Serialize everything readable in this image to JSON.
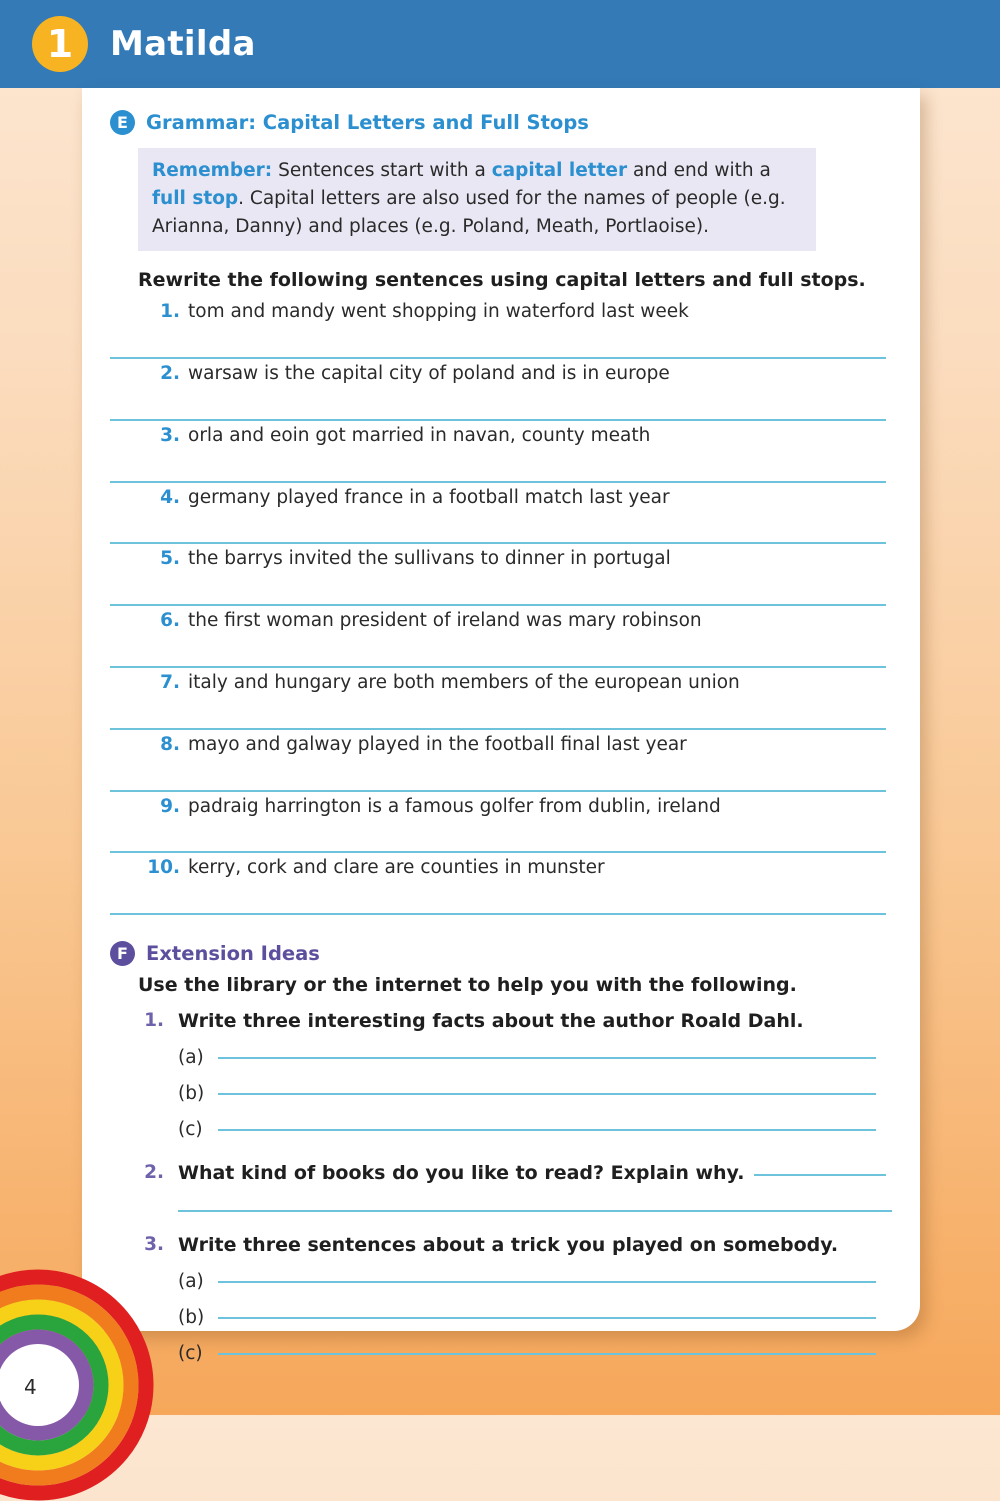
{
  "banner": {
    "chapter_number": "1",
    "title": "Matilda",
    "banner_color": "#337ab7",
    "badge_color": "#f7b322"
  },
  "section_e": {
    "badge": "E",
    "badge_color": "#2b8fd0",
    "title": "Grammar: Capital Letters and Full Stops",
    "remember": {
      "label": "Remember:",
      "part1": " Sentences start with a ",
      "highlight1": "capital letter",
      "part2": " and end with a ",
      "highlight2": "full stop",
      "part3": ". Capital letters are also used for the names of people (e.g. Arianna, Danny) and places (e.g. Poland, Meath, Portlaoise).",
      "background_color": "#e8e7f3"
    },
    "instruction": "Rewrite the following sentences using capital letters and full stops.",
    "items": [
      {
        "number": "1.",
        "text": "tom and mandy went shopping in waterford last week"
      },
      {
        "number": "2.",
        "text": "warsaw is the capital city of poland and is in europe"
      },
      {
        "number": "3.",
        "text": "orla and eoin got married in navan, county meath"
      },
      {
        "number": "4.",
        "text": "germany played france in a football match last year"
      },
      {
        "number": "5.",
        "text": "the barrys invited the sullivans to dinner in portugal"
      },
      {
        "number": "6.",
        "text": "the first woman president of ireland was mary robinson"
      },
      {
        "number": "7.",
        "text": "italy and hungary are both members of the european union"
      },
      {
        "number": "8.",
        "text": "mayo and galway played in the football final last year"
      },
      {
        "number": "9.",
        "text": "padraig harrington is a famous golfer from dublin, ireland"
      },
      {
        "number": "10.",
        "text": "kerry, cork and clare are counties in munster"
      }
    ]
  },
  "section_f": {
    "badge": "F",
    "badge_color": "#5d4f9e",
    "title": "Extension Ideas",
    "intro": "Use the library or the internet to help you with the following.",
    "items": [
      {
        "number": "1.",
        "question": "Write three interesting facts about the author Roald Dahl.",
        "sub_labels": [
          "(a)",
          "(b)",
          "(c)"
        ]
      },
      {
        "number": "2.",
        "question": "What kind of books do you like to read? Explain why.",
        "sub_labels": []
      },
      {
        "number": "3.",
        "question": "Write three sentences about a trick you played on somebody.",
        "sub_labels": [
          "(a)",
          "(b)",
          "(c)"
        ]
      }
    ]
  },
  "footer": {
    "page_number": "4",
    "rainbow_colors": [
      "#e02020",
      "#f07c1e",
      "#f6d117",
      "#2aa43c",
      "#8559a8"
    ]
  },
  "theme": {
    "rule_color": "#6cc3db",
    "number_color": "#2b8fd0",
    "ext_number_color": "#6f62ad",
    "text_color": "#2a2a2a",
    "page_bg_top": "#fce7d2",
    "page_bg_bottom": "#f6a75a"
  }
}
